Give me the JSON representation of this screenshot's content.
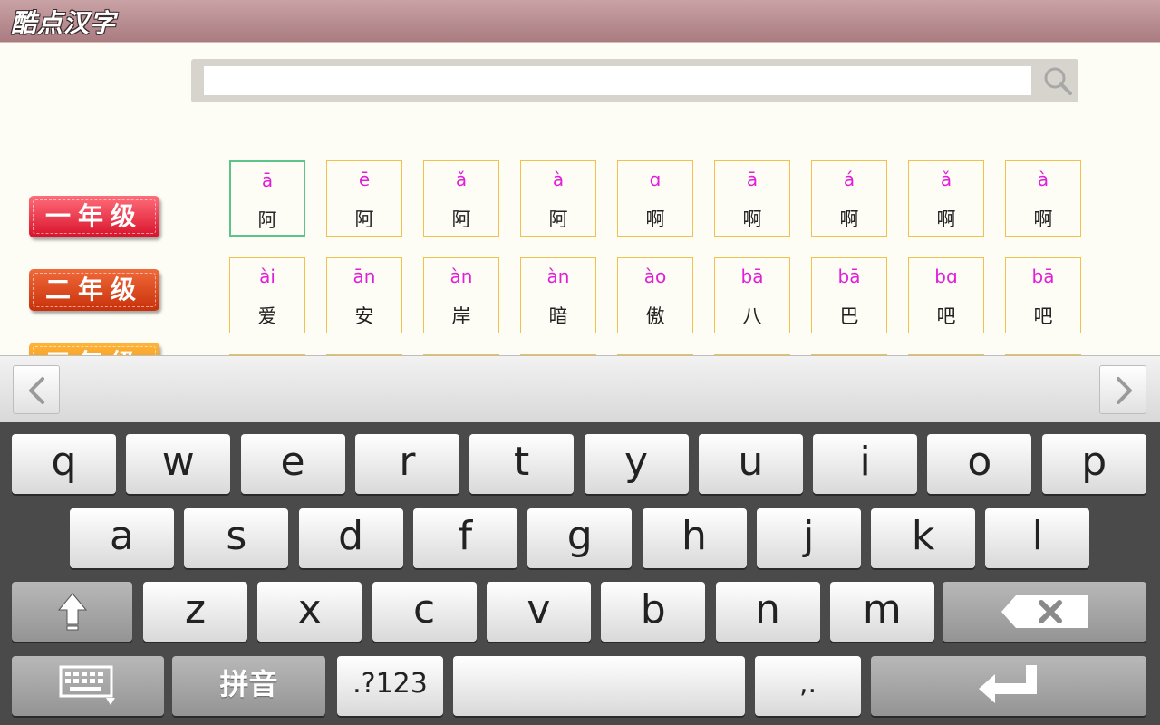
{
  "app": {
    "title": "酷点汉字"
  },
  "search": {
    "placeholder": "",
    "value": ""
  },
  "grades": [
    "一年级",
    "二年级",
    "三年级"
  ],
  "characters": [
    [
      {
        "pinyin": "ā",
        "hanzi": "阿"
      },
      {
        "pinyin": "ē",
        "hanzi": "阿"
      },
      {
        "pinyin": "ǎ",
        "hanzi": "阿"
      },
      {
        "pinyin": "à",
        "hanzi": "阿"
      },
      {
        "pinyin": "ɑ",
        "hanzi": "啊"
      },
      {
        "pinyin": "ā",
        "hanzi": "啊"
      },
      {
        "pinyin": "á",
        "hanzi": "啊"
      },
      {
        "pinyin": "ǎ",
        "hanzi": "啊"
      },
      {
        "pinyin": "à",
        "hanzi": "啊"
      }
    ],
    [
      {
        "pinyin": "ài",
        "hanzi": "爱"
      },
      {
        "pinyin": "ān",
        "hanzi": "安"
      },
      {
        "pinyin": "àn",
        "hanzi": "岸"
      },
      {
        "pinyin": "àn",
        "hanzi": "暗"
      },
      {
        "pinyin": "ào",
        "hanzi": "傲"
      },
      {
        "pinyin": "bā",
        "hanzi": "八"
      },
      {
        "pinyin": "bā",
        "hanzi": "巴"
      },
      {
        "pinyin": "bɑ",
        "hanzi": "吧"
      },
      {
        "pinyin": "bā",
        "hanzi": "吧"
      }
    ]
  ],
  "selected_cell": [
    0,
    0
  ],
  "keyboard": {
    "row1": [
      "q",
      "w",
      "e",
      "r",
      "t",
      "y",
      "u",
      "i",
      "o",
      "p"
    ],
    "row2": [
      "a",
      "s",
      "d",
      "f",
      "g",
      "h",
      "j",
      "k",
      "l"
    ],
    "row3": [
      "z",
      "x",
      "c",
      "v",
      "b",
      "n",
      "m"
    ],
    "pinyin_label": "拼音",
    "symbols_label": ".?123",
    "punct_label": ",.",
    "icons": {
      "shift": "shift-arrow-icon",
      "backspace": "backspace-icon",
      "enter": "enter-icon",
      "hide": "keyboard-hide-icon"
    }
  },
  "colors": {
    "pinyin": "#e020d8",
    "cell_border": "#f0c24a",
    "selected_border": "#5cc38a"
  }
}
